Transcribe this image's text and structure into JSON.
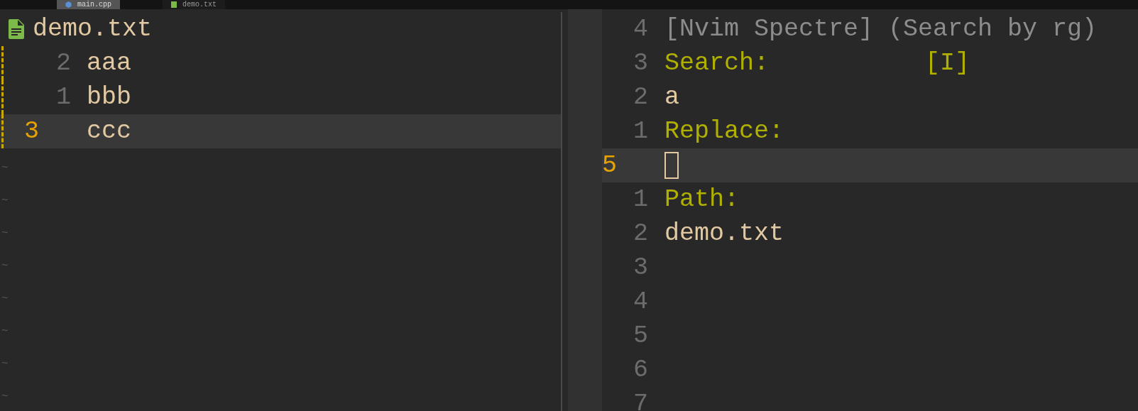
{
  "tabs": [
    {
      "label": "main.cpp",
      "selected": true,
      "kind": "cpp"
    },
    {
      "label": "demo.txt",
      "selected": false,
      "kind": "text"
    }
  ],
  "left_pane": {
    "winbar": {
      "label": "demo.txt",
      "kind": "text"
    },
    "lines": [
      {
        "number": "2",
        "text": "aaa",
        "current": false,
        "changed": true
      },
      {
        "number": "1",
        "text": "bbb",
        "current": false,
        "changed": true
      },
      {
        "number": "3",
        "text": "ccc",
        "current": true,
        "changed": true
      }
    ],
    "filler": [
      "~",
      "~",
      "~",
      "~",
      "~",
      "~",
      "~",
      "~"
    ]
  },
  "right_pane": {
    "lines": [
      {
        "number": "4",
        "text": "[Nvim Spectre] (Search by rg)",
        "kind": "title",
        "current": false
      },
      {
        "number": "3",
        "text": "Search:",
        "kind": "label",
        "current": false,
        "flag": "[I]"
      },
      {
        "number": "2",
        "text": "a",
        "kind": "value",
        "current": false
      },
      {
        "number": "1",
        "text": "Replace:",
        "kind": "label",
        "current": false
      },
      {
        "number": "5",
        "kind": "cursor",
        "current": true
      },
      {
        "number": "1",
        "text": "Path:",
        "kind": "label",
        "current": false
      },
      {
        "number": "2",
        "text": "demo.txt",
        "kind": "value",
        "current": false
      },
      {
        "number": "3",
        "kind": "empty",
        "current": false
      },
      {
        "number": "4",
        "kind": "empty",
        "current": false
      },
      {
        "number": "5",
        "kind": "empty",
        "current": false
      },
      {
        "number": "6",
        "kind": "empty",
        "current": false
      },
      {
        "number": "7",
        "kind": "empty",
        "current": false
      }
    ]
  }
}
